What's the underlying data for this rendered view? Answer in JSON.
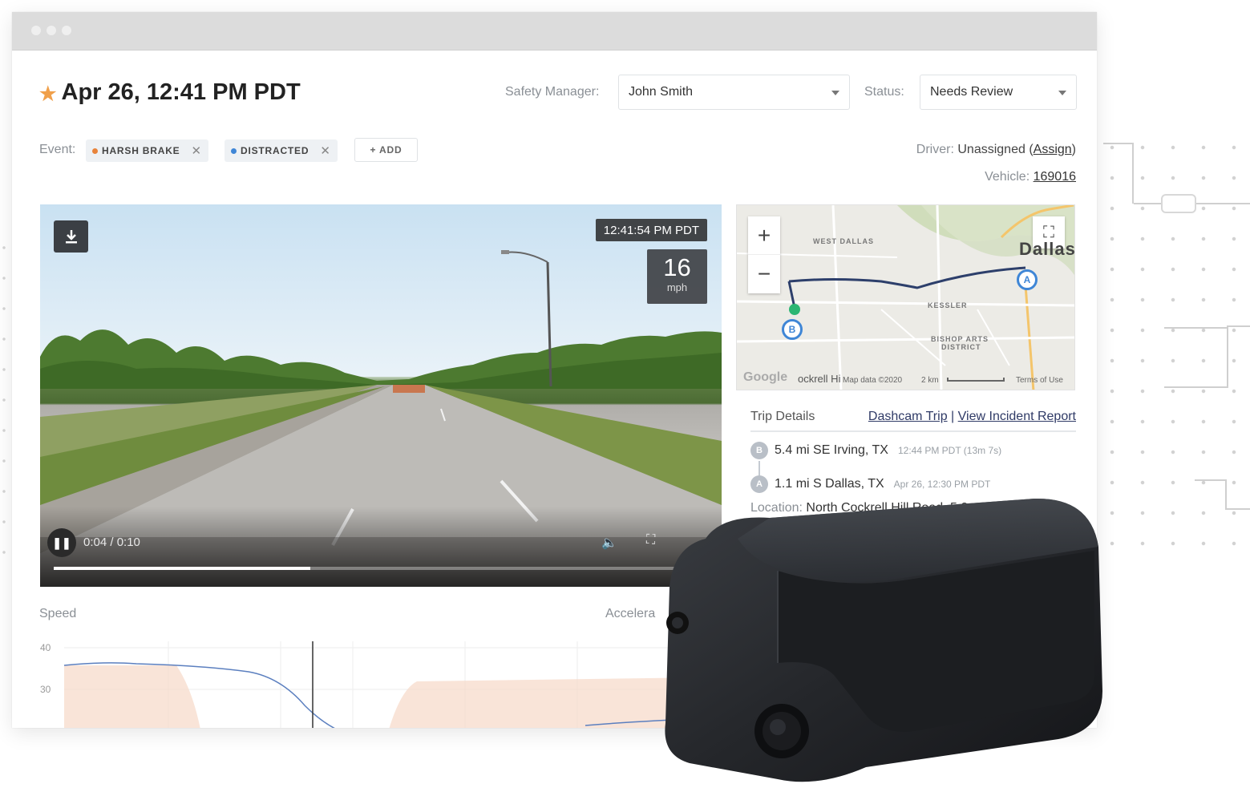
{
  "header": {
    "title": "Apr 26, 12:41 PM PDT",
    "safety_manager_label": "Safety Manager:",
    "safety_manager_value": "John Smith",
    "status_label": "Status:",
    "status_value": "Needs Review"
  },
  "event": {
    "label": "Event:",
    "tags": [
      {
        "label": "HARSH BRAKE",
        "color": "#e8833a"
      },
      {
        "label": "DISTRACTED",
        "color": "#3f86d6"
      }
    ],
    "add_label": "+ ADD"
  },
  "assignment": {
    "driver_label": "Driver:",
    "driver_value": "Unassigned",
    "assign_link": "Assign",
    "vehicle_label": "Vehicle:",
    "vehicle_value": "169016"
  },
  "video": {
    "timestamp": "12:41:54 PM PDT",
    "speed_value": "16",
    "speed_unit": "mph",
    "time_display": "0:04 / 0:10",
    "progress": 0.4
  },
  "map": {
    "labels": [
      "WEST DALLAS",
      "KESSLER",
      "BISHOP ARTS",
      "DISTRICT",
      "Dallas"
    ],
    "zoom_in": "+",
    "zoom_out": "−",
    "footer_logo": "Google",
    "footer_street": "ockrell Hi",
    "footer_data": "Map data ©2020",
    "footer_scale": "2 km",
    "footer_terms": "Terms of Use",
    "marker_a": "A",
    "marker_b": "B"
  },
  "trip": {
    "title": "Trip Details",
    "link1": "Dashcam Trip",
    "separator": "|",
    "link2": "View Incident Report",
    "stops": [
      {
        "pin": "B",
        "place": "5.4 mi SE Irving, TX",
        "detail": "12:44 PM PDT (13m 7s)"
      },
      {
        "pin": "A",
        "place": "1.1 mi S Dallas, TX",
        "detail": "Apr 26, 12:30 PM PDT"
      }
    ],
    "location_label": "Location:",
    "location_value": "North Cockrell Hill Road, 5.0"
  },
  "charts": {
    "speed_title": "Speed",
    "accel_title": "Accelera",
    "y_ticks": [
      "40",
      "30"
    ]
  },
  "colors": {
    "accent_star": "#f0a04b",
    "harsh_brake": "#e8833a",
    "distracted": "#3f86d6",
    "route": "#2d3f6b",
    "speed_line": "#5b7fbf",
    "speed_fill": "#f6d8c8"
  }
}
